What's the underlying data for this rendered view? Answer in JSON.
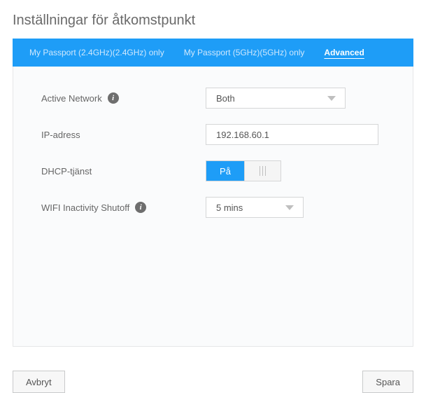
{
  "title": "Inställningar för åtkomstpunkt",
  "tabs": {
    "t0": "My Passport (2.4GHz)(2.4GHz) only",
    "t1": "My Passport (5GHz)(5GHz) only",
    "t2": "Advanced"
  },
  "labels": {
    "active_network": "Active Network",
    "ip_address": "IP-adress",
    "dhcp": "DHCP-tjänst",
    "wifi_shutoff": "WIFI Inactivity Shutoff"
  },
  "values": {
    "active_network": "Both",
    "ip_address": "192.168.60.1",
    "dhcp_on": "På",
    "wifi_shutoff": "5 mins"
  },
  "buttons": {
    "cancel": "Avbryt",
    "save": "Spara"
  },
  "icons": {
    "info_glyph": "i"
  }
}
